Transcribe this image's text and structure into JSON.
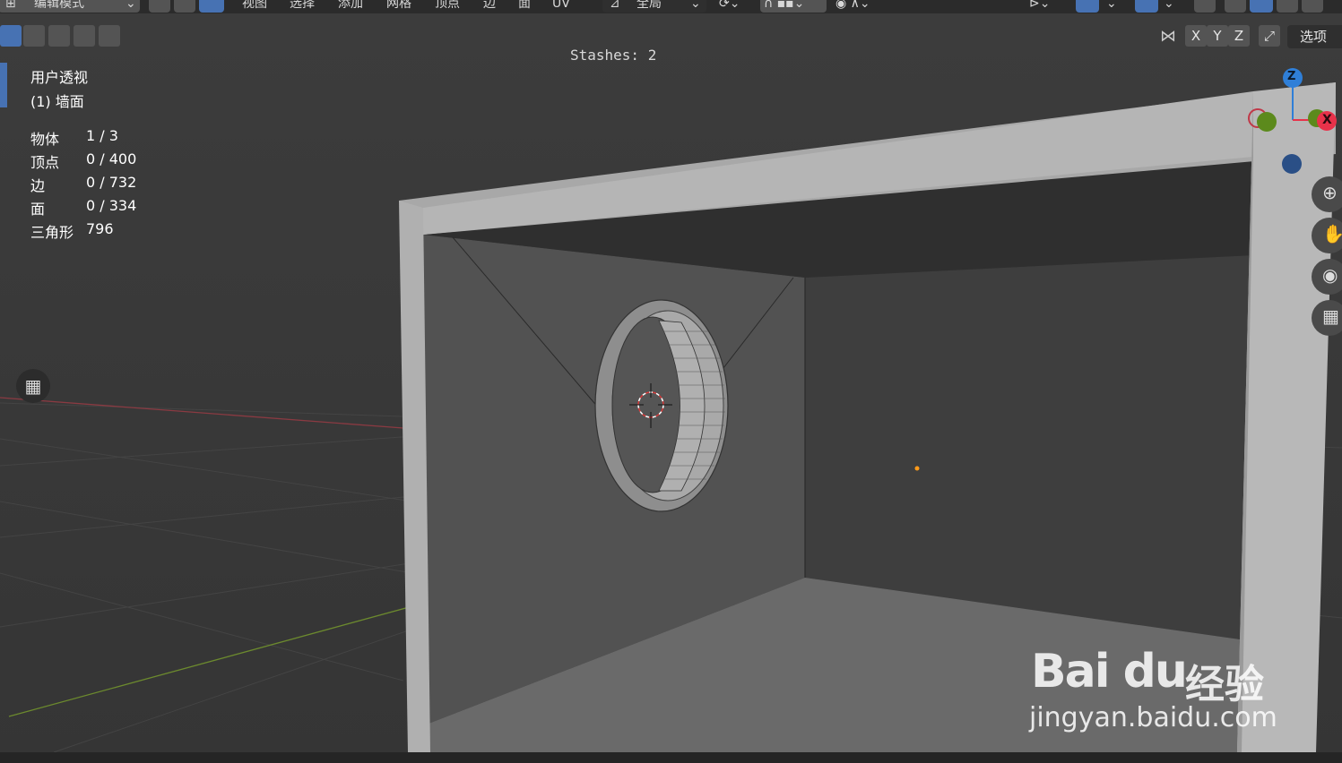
{
  "header": {
    "mode_label": "编辑模式",
    "menu": [
      "视图",
      "选择",
      "添加",
      "网格",
      "顶点",
      "边",
      "面",
      "UV"
    ],
    "transform_orientation": "全局"
  },
  "toolbar": {
    "axis_x": "X",
    "axis_y": "Y",
    "axis_z": "Z",
    "options_label": "选项"
  },
  "overlay": {
    "stashes": "Stashes: 2"
  },
  "viewport_info": {
    "view_name": "用户透视",
    "object_name": "(1) 墙面",
    "stats": [
      {
        "label": "物体",
        "value": "1 / 3"
      },
      {
        "label": "顶点",
        "value": "0 / 400"
      },
      {
        "label": "边",
        "value": "0 / 732"
      },
      {
        "label": "面",
        "value": "0 / 334"
      },
      {
        "label": "三角形",
        "value": "796"
      }
    ]
  },
  "gizmo": {
    "z_label": "Z",
    "x_label": "X",
    "colors": {
      "x": "#e8324a",
      "y": "#6b9a1f",
      "z": "#2f7fd8"
    }
  },
  "icons": [
    "zoom-icon",
    "hand-pan-icon",
    "camera-icon",
    "grid-ortho-icon",
    "checker-icon"
  ],
  "watermark": {
    "logo": "Bai du",
    "cn": "经验",
    "url": "jingyan.baidu.com"
  },
  "colors": {
    "accent": "#4772b3",
    "background": "#3a3a3a",
    "x_axis": "#b0404a",
    "y_axis": "#6f8f2f"
  }
}
